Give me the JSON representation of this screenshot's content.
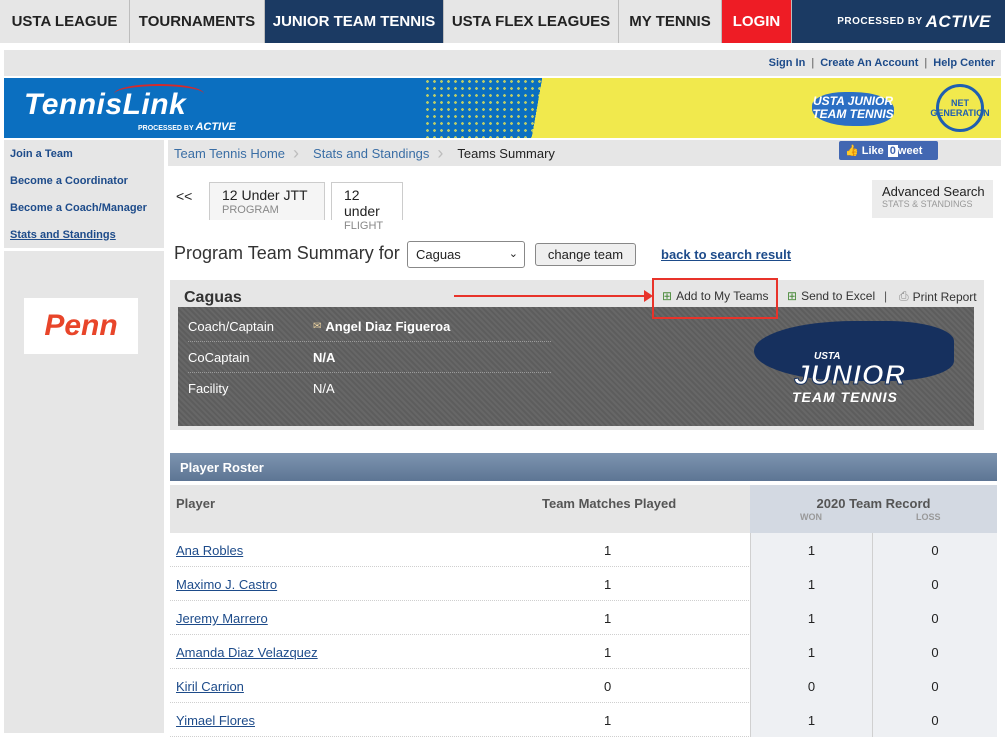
{
  "topnav": {
    "tabs": [
      {
        "label": "USTA LEAGUE"
      },
      {
        "label": "TOURNAMENTS"
      },
      {
        "label": "JUNIOR TEAM TENNIS"
      },
      {
        "label": "USTA FLEX LEAGUES"
      },
      {
        "label": "MY TENNIS"
      },
      {
        "label": "LOGIN"
      }
    ],
    "processed_by": "PROCESSED BY",
    "active_brand": "ACTIVE"
  },
  "utilbar": {
    "sign_in": "Sign In",
    "create_account": "Create An Account",
    "help_center": "Help Center",
    "sep": "|"
  },
  "banner": {
    "logo_text": "TennisLink",
    "processed_by": "PROCESSED BY",
    "active": "ACTIVE",
    "jtt_badge": "USTA JUNIOR TEAM TENNIS",
    "ng_badge": "NET GENERATION"
  },
  "sidebar": {
    "items": [
      {
        "label": "Join a Team"
      },
      {
        "label": "Become a Coordinator"
      },
      {
        "label": "Become a Coach/Manager"
      },
      {
        "label": "Stats and Standings"
      }
    ],
    "sponsor": "Penn"
  },
  "breadcrumb": {
    "items": [
      "Team Tennis Home",
      "Stats and Standings",
      "Teams Summary"
    ]
  },
  "facebook": {
    "like": "Like",
    "count": "0",
    "tweet": "weet"
  },
  "tabsrow": {
    "back": "<<",
    "program_tab": {
      "title": "12 Under JTT",
      "sub": "PROGRAM"
    },
    "flight_tab": {
      "title": "12 under",
      "sub": "FLIGHT"
    },
    "advanced_search": {
      "title": "Advanced Search",
      "sub": "STATS & STANDINGS"
    }
  },
  "summary": {
    "title": "Program Team Summary for",
    "selected_team": "Caguas",
    "change_team": "change team",
    "back_link": "back to search result"
  },
  "team": {
    "name": "Caguas",
    "actions": {
      "add": "Add to My Teams",
      "excel": "Send to Excel",
      "sep": "|",
      "print": "Print Report"
    },
    "info": [
      {
        "label": "Coach/Captain",
        "value": "Angel Diaz Figueroa"
      },
      {
        "label": "CoCaptain",
        "value": "N/A"
      },
      {
        "label": "Facility",
        "value": "N/A"
      }
    ],
    "logo": {
      "usta": "USTA",
      "junior": "JUNIOR",
      "tt": "TEAM TENNIS"
    }
  },
  "roster": {
    "title": "Player Roster",
    "headers": {
      "player": "Player",
      "matches": "Team Matches Played",
      "record": "2020 Team Record",
      "won": "WON",
      "loss": "LOSS"
    },
    "rows": [
      {
        "name": "Ana Robles",
        "matches": "1",
        "won": "1",
        "loss": "0"
      },
      {
        "name": "Maximo J. Castro",
        "matches": "1",
        "won": "1",
        "loss": "0"
      },
      {
        "name": "Jeremy Marrero",
        "matches": "1",
        "won": "1",
        "loss": "0"
      },
      {
        "name": "Amanda Diaz Velazquez",
        "matches": "1",
        "won": "1",
        "loss": "0"
      },
      {
        "name": "Kiril Carrion",
        "matches": "0",
        "won": "0",
        "loss": "0"
      },
      {
        "name": "Yimael Flores",
        "matches": "1",
        "won": "1",
        "loss": "0"
      }
    ]
  },
  "colors": {
    "navy": "#1b3a63",
    "login_red": "#ee1c25",
    "link_blue": "#1d4b8a",
    "banner_blue": "#0b6fc0",
    "banner_yellow": "#f1e94d",
    "highlight_red": "#e8332a"
  }
}
